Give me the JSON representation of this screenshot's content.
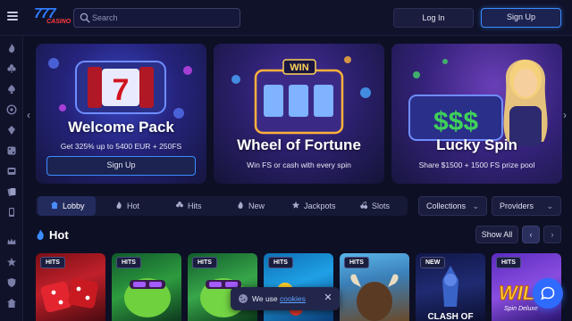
{
  "header": {
    "logo_number": "777",
    "logo_text": "CASINO",
    "search_placeholder": "Search",
    "login_label": "Log In",
    "signup_label": "Sign Up"
  },
  "sidebar": {
    "icons": [
      "fire-icon",
      "clover-icon",
      "ace-spade-icon",
      "roulette-icon",
      "crystal-icon",
      "dice-icon",
      "slot-icon",
      "cards-icon",
      "star-icon",
      "phone-icon",
      "crown-icon",
      "shield-icon",
      "lobby-icon"
    ]
  },
  "banners": [
    {
      "title": "Welcome Pack",
      "subtitle": "Get 325% up to 5400 EUR + 250FS",
      "cta": "Sign Up",
      "reel_symbol": "7"
    },
    {
      "title": "Wheel of Fortune",
      "subtitle": "Win FS or cash with every spin",
      "sign": "WIN"
    },
    {
      "title": "Lucky Spin",
      "subtitle": "Share $1500 + 1500 FS prize pool",
      "reel_symbols": "$$$"
    }
  ],
  "tabs": [
    {
      "label": "Lobby",
      "icon": "lobby-icon",
      "active": true
    },
    {
      "label": "Hot",
      "icon": "fire-icon",
      "active": false
    },
    {
      "label": "Hits",
      "icon": "clover-icon",
      "active": false
    },
    {
      "label": "New",
      "icon": "flame-icon",
      "active": false
    },
    {
      "label": "Jackpots",
      "icon": "star-icon",
      "active": false
    },
    {
      "label": "Slots",
      "icon": "cherry-icon",
      "active": false
    }
  ],
  "filters": {
    "collections_label": "Collections",
    "providers_label": "Providers"
  },
  "hot_section": {
    "title": "Hot",
    "show_all_label": "Show All",
    "prev_label": "‹",
    "next_label": "›",
    "games": [
      {
        "badge": "HITS",
        "art": "dice"
      },
      {
        "badge": "HITS",
        "art": "frog"
      },
      {
        "badge": "HITS",
        "art": "frog"
      },
      {
        "badge": "HITS",
        "art": "fruits"
      },
      {
        "badge": "HITS",
        "art": "buffalo"
      },
      {
        "badge": "NEW",
        "art": "warrior",
        "visible_text": "CLASH OF"
      },
      {
        "badge": "HITS",
        "art": "wild",
        "visible_text": "WIL",
        "visible_sub": "Spin Deluxe"
      }
    ]
  },
  "cookie": {
    "text": "We use",
    "link": "cookies",
    "close": "✕"
  },
  "colors": {
    "background": "#0d0f24",
    "accent_blue": "#3b8dff",
    "logo_red": "#ff3b3b",
    "chat_blue": "#2f6bff"
  }
}
